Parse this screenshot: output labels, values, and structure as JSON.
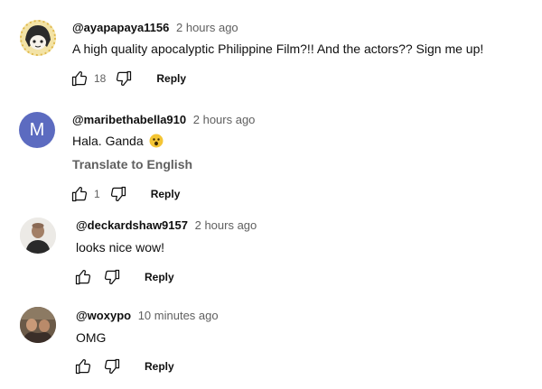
{
  "comments": [
    {
      "author": "@ayapapaya1156",
      "time": "2 hours ago",
      "text": "A high quality apocalyptic Philippine Film?!! And the actors?? Sign me up!",
      "likes": "18",
      "reply_label": "Reply",
      "avatar_icon": "cartoon-avatar-icon"
    },
    {
      "author": "@maribethabella910",
      "time": "2 hours ago",
      "text": "Hala. Ganda",
      "emoji_icon": "astonished-face-emoji",
      "translate_label": "Translate to English",
      "likes": "1",
      "reply_label": "Reply",
      "avatar_letter": "M",
      "avatar_color": "#5c6bc0"
    },
    {
      "author": "@deckardshaw9157",
      "time": "2 hours ago",
      "text": "looks nice wow!",
      "reply_label": "Reply",
      "avatar_icon": "photo-avatar-icon"
    },
    {
      "author": "@woxypo",
      "time": "10 minutes ago",
      "text": "OMG",
      "reply_label": "Reply",
      "avatar_icon": "photo-avatar-icon"
    }
  ]
}
